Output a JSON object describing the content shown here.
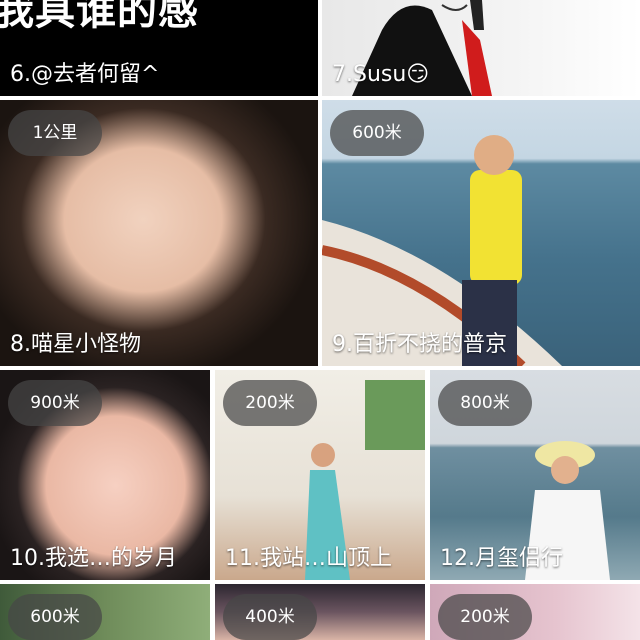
{
  "banner_text": "我具谁的感",
  "cards": [
    {
      "caption": "6.@去者何留^",
      "distance": null
    },
    {
      "caption": "7.Susu😏",
      "distance": null
    },
    {
      "caption": "8.喵星小怪物",
      "distance": "1公里"
    },
    {
      "caption": "9.百折不挠的普京",
      "distance": "600米"
    },
    {
      "caption": "10.我选…的岁月",
      "distance": "900米"
    },
    {
      "caption": "11.我站…山顶上",
      "distance": "200米"
    },
    {
      "caption": "12.月玺侣行",
      "distance": "800米"
    },
    {
      "caption": "",
      "distance": "600米"
    },
    {
      "caption": "",
      "distance": "400米"
    },
    {
      "caption": "",
      "distance": "200米"
    }
  ],
  "colors": {
    "badge_bg": "#464646",
    "caption_text": "#ffffff",
    "divider": "#ffffff"
  }
}
